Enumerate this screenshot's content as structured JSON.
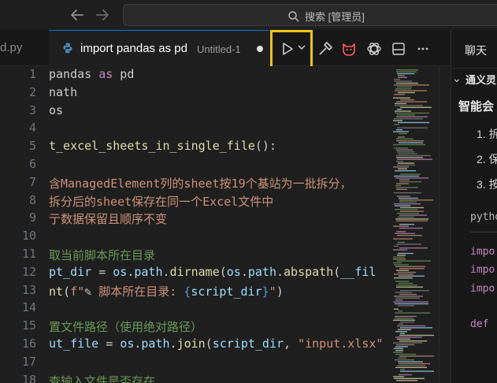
{
  "titlebar": {
    "search_text": "搜索 [管理员]",
    "back_icon": "arrow-left-icon",
    "forward_icon": "arrow-right-icon"
  },
  "tabs": {
    "previous_tab_label": "d.py",
    "active_tab_label": "import pandas as pd",
    "active_tab_sub": "Untitled-1"
  },
  "right_panel": {
    "tab_label": "聊天",
    "section_label": "通义灵",
    "heading": "智能会",
    "list_items": [
      "1. 拆",
      "2. 保",
      "3. 按"
    ],
    "code_lang": "pytho",
    "code_lines": [
      "impo",
      "impo",
      "impo",
      "def"
    ]
  },
  "editor": {
    "line_numbers": [
      "1",
      "2",
      "3",
      "4",
      "5",
      "6",
      "7",
      "8",
      "9",
      "10",
      "11",
      "12",
      "13",
      "14",
      "15",
      "16",
      "17",
      "18"
    ],
    "lines": [
      {
        "parts": [
          {
            "t": "pandas ",
            "c": "plain"
          },
          {
            "t": "as",
            "c": "kw"
          },
          {
            "t": " pd",
            "c": "plain"
          }
        ]
      },
      {
        "parts": [
          {
            "t": "nath",
            "c": "plain"
          }
        ]
      },
      {
        "parts": [
          {
            "t": "os",
            "c": "plain"
          }
        ]
      },
      {
        "parts": []
      },
      {
        "parts": [
          {
            "t": "t_excel_sheets_in_single_file",
            "c": "fn"
          },
          {
            "t": "():",
            "c": "plain"
          }
        ]
      },
      {
        "parts": []
      },
      {
        "parts": [
          {
            "t": "含ManagedElement列的sheet按19个基站为一批拆分",
            "c": "doc"
          },
          {
            "t": "，",
            "c": "doc"
          }
        ]
      },
      {
        "parts": [
          {
            "t": "拆分后的sheet保存在同一个Excel文件中",
            "c": "doc"
          }
        ]
      },
      {
        "parts": [
          {
            "t": "亍数据保留且顺序不变",
            "c": "doc"
          }
        ]
      },
      {
        "parts": []
      },
      {
        "parts": [
          {
            "t": "取当前脚本所在目录",
            "c": "cm"
          }
        ]
      },
      {
        "parts": [
          {
            "t": "pt_dir",
            "c": "var"
          },
          {
            "t": " = ",
            "c": "plain"
          },
          {
            "t": "os",
            "c": "var"
          },
          {
            "t": ".",
            "c": "plain"
          },
          {
            "t": "path",
            "c": "var"
          },
          {
            "t": ".",
            "c": "plain"
          },
          {
            "t": "dirname",
            "c": "fn"
          },
          {
            "t": "(",
            "c": "plain"
          },
          {
            "t": "os",
            "c": "var"
          },
          {
            "t": ".",
            "c": "plain"
          },
          {
            "t": "path",
            "c": "var"
          },
          {
            "t": ".",
            "c": "plain"
          },
          {
            "t": "abspath",
            "c": "fn"
          },
          {
            "t": "(",
            "c": "plain"
          },
          {
            "t": "__fil",
            "c": "var"
          }
        ]
      },
      {
        "parts": [
          {
            "t": "nt",
            "c": "fn"
          },
          {
            "t": "(",
            "c": "plain"
          },
          {
            "t": "f\"",
            "c": "str"
          },
          {
            "t": "✎",
            "c": "plain"
          },
          {
            "t": " 脚本所在目录: ",
            "c": "str"
          },
          {
            "t": "{",
            "c": "brace"
          },
          {
            "t": "script_dir",
            "c": "var"
          },
          {
            "t": "}",
            "c": "brace"
          },
          {
            "t": "\"",
            "c": "str"
          },
          {
            "t": ")",
            "c": "plain"
          }
        ]
      },
      {
        "parts": []
      },
      {
        "parts": [
          {
            "t": "置文件路径（使用绝对路径）",
            "c": "cm"
          }
        ]
      },
      {
        "parts": [
          {
            "t": "ut_file",
            "c": "var"
          },
          {
            "t": " = ",
            "c": "plain"
          },
          {
            "t": "os",
            "c": "var"
          },
          {
            "t": ".",
            "c": "plain"
          },
          {
            "t": "path",
            "c": "var"
          },
          {
            "t": ".",
            "c": "plain"
          },
          {
            "t": "join",
            "c": "fn"
          },
          {
            "t": "(",
            "c": "plain"
          },
          {
            "t": "script_dir",
            "c": "var"
          },
          {
            "t": ", ",
            "c": "plain"
          },
          {
            "t": "\"input.xlsx\"",
            "c": "str"
          }
        ]
      },
      {
        "parts": []
      },
      {
        "parts": [
          {
            "t": "查输入文件是否存在",
            "c": "cm"
          }
        ]
      }
    ]
  },
  "icons": {
    "run": "play-icon",
    "run_menu": "chevron-down-icon",
    "build": "hammer-icon",
    "assistant": "cat-face-icon",
    "chatgpt": "openai-icon",
    "layout": "panel-layout-icon",
    "more": "more-icon"
  }
}
